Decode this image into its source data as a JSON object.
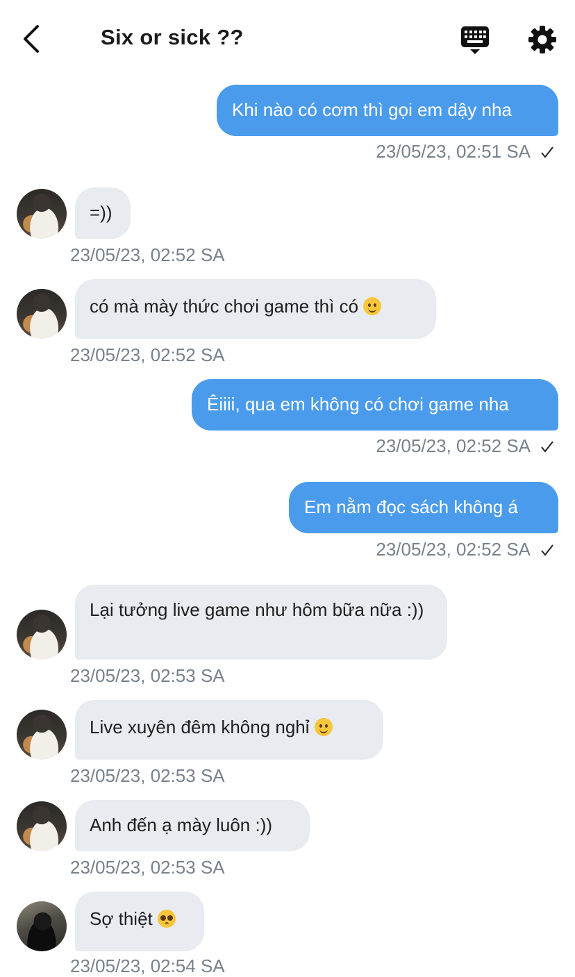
{
  "header": {
    "title": "Six or sick ??"
  },
  "messages": [
    {
      "text": "Khi nào có cơm thì gọi em dậy nha",
      "time": "23/05/23, 02:51 SA"
    },
    {
      "text": "=))",
      "time": "23/05/23, 02:52 SA"
    },
    {
      "text": "có mà mày thức chơi game thì có",
      "time": "23/05/23, 02:52 SA"
    },
    {
      "text": "Êiiii, qua em không có chơi game nha",
      "time": "23/05/23, 02:52 SA"
    },
    {
      "text": "Em nằm đọc sách không á",
      "time": "23/05/23, 02:52 SA"
    },
    {
      "text": "Lại tưởng live game như hôm bữa nữa :))",
      "time": "23/05/23, 02:53 SA"
    },
    {
      "text": "Live xuyên đêm không nghỉ",
      "time": "23/05/23, 02:53 SA"
    },
    {
      "text": "Anh đến ạ mày luôn :))",
      "time": "23/05/23, 02:53 SA"
    },
    {
      "text": "Sợ thiệt",
      "time": "23/05/23, 02:54 SA"
    }
  ],
  "colors": {
    "sent_bubble": "#4a9beb",
    "received_bubble": "#e8ebef",
    "timestamp": "#77818d"
  }
}
